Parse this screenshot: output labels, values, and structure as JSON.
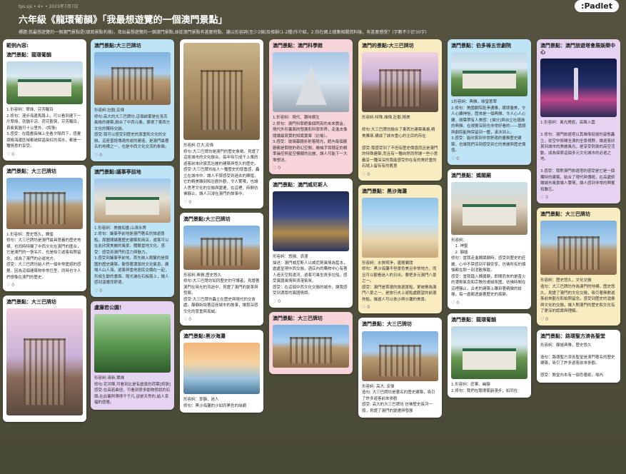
{
  "header": {
    "meta": "tps.sjs • 4+ • 2025年7月7日",
    "title": "六年級《龍環葡韻》「我最想遊覽的一個澳門景點」",
    "subtitle": "標題:我最想遊覽的一個澳門景點是(填寫景點名稱)，寫出最想遊覽的一個澳門景點,並從澳門景點有甚麼特點、讓以形容詞(至少2個)及修辭(1-2種)作介紹，2.你在網上搜集相關資料後，有甚麼感受？(字數不少於30字)",
    "logo": ":Padlet"
  },
  "columns": [
    {
      "cards": [
        {
          "color": "white",
          "title": "範例內容:",
          "subtitle": "澳門景點：龍環葡韻",
          "img": "img-green",
          "imgh": 60,
          "shape": "building",
          "body": "1.形容詞：翠綠、芬芳醒目\n2.修句：漫步海邊馬路上，可以看到建下一片翠綠，就猶平涼、荷花觀賞，芬芳醒目，真氣氣猶可十公里外。(誇張)\n3.感受：在踏盡長梯上坐看夕陽西下，感覺領略海邊區域都被餘昌染紅的海水，都是一種情意的享受。",
          "reacts": "0"
        },
        {
          "color": "white",
          "title": "澳門景點：大三巴牌坊",
          "subtitle": "",
          "img": "img-ruins",
          "imgh": 72,
          "shape": "facade",
          "body": "1.形容詞：歷史悠久，輝煌\n修句：大三巴牌坊是澳門最具意義的歷史地標，也同時特顯了中西文化在澳門的匯合，它是澳門的一張名片，也是吸引遊客拍照留念，成為了澳門的必遊地方。\n感受：大三巴牌坊給人們一個非常震撼的感覺，因為這個建築物非常巨型，同時也令人們想像在澳門的歷史。",
          "reacts": "0"
        },
        {
          "color": "white",
          "title": "澳門景點：大三巴牌坊",
          "subtitle": "",
          "img": "img-ruinsdusk",
          "imgh": 150,
          "shape": "facade",
          "body": "",
          "reacts": ""
        }
      ]
    },
    {
      "cards": [
        {
          "color": "blue",
          "title": "澳門景點:大三巴牌坊",
          "subtitle": "",
          "img": "img-ruins",
          "imgh": 74,
          "shape": "facade",
          "body": "形容詞:壯觀,宏偉\n修句:高大的大三巴牌坊,這個啟蒙是在洛克風格的建築,融合了中西元素，展現了東西方文化的獨特交融。\n感受:我可以感受到歷史的厚重和文化的交融，這座曾經傳達的遊的建造，是澳門最著名的地標之一，也是中西文化交流的象徵。",
          "reacts": "0"
        },
        {
          "color": "blue",
          "title": "澳門景點:議事亭前地",
          "subtitle": "",
          "img": "img-street",
          "imgh": 62,
          "shape": "building",
          "body": "1.形容詞：美麗如畫,山清水秀\n2.修句：議事亭前地是澳門著名的旅遊景點，周圍環繞著歷史建築和商店，遊客可以在此欣賞美麗的風景，體驗當地文化。感受：感受到澳門的活力與魅力。\n3.感受到議事亭前地，首先映入眼簾的是周圍的歷史建築，散發著濃厚的文化氣息，廣場人山人海，遊客與當地居民交織在一起，形成生動的畫面。陽光灑在石板路上，讓人感到溫暖而舒適。",
          "reacts": "0"
        },
        {
          "color": "purple",
          "title": "盧廉若公園！",
          "subtitle": "",
          "img": "img-garden",
          "imgh": 82,
          "shape": "",
          "body": "形容詞:清新,翠綠\n修句:花河陣,可看到比是有處景的荷葉[誇張]　　感受:在高若曲徑，可看到很多動物很狀的石頭,在此裏則博得千千凡,卻是天然的,給人幸福的感覺。",
          "reacts": ""
        }
      ]
    },
    {
      "cards": [
        {
          "color": "white",
          "title": "",
          "subtitle": "",
          "img": "img-stone",
          "imgh": 136,
          "shape": "facade",
          "body": "形容詞:巨大,宏偉\n修句:大三巴牌坊是澳門的歷史象徵，見證了這座城市的文化融合，每年吸引成千上萬的遊客前來欣賞其壯麗的建築與悠久的歷史。\n感受:大三巴牌坊給人一種歷史的厚重感，矗立在城市中，讓人不禁感受到過去的輝煌，它的精美雕刻和壯觀外觀，令人驚嘆，也讓人思考文化的交融與變遷，在這裡，時間彷彿靜止，讓人沉浸在澳門的故事中。",
          "reacts": "0"
        },
        {
          "color": "white",
          "title": "澳門景點:大三巴牌坊",
          "subtitle": "",
          "img": "img-ruins",
          "imgh": 62,
          "shape": "facade",
          "body": "形容詞:典雅,歷史悠久\n修句:大三巴牌坊如同歷史的守護者，見證著澳門在時光的流逝中，見證了澳門的變革與發展。\n感受:大三巴牌坊矗立在歷史與現代的交會處，靜靜訴說著這座城市的故事，讓我深感文化的厚重與真誠。",
          "reacts": "0"
        },
        {
          "color": "white",
          "title": "澳門景點:黑沙海灘",
          "subtitle": "",
          "img": "img-sunset",
          "imgh": 72,
          "shape": "",
          "body": "形容詞：寧靜，迷人\n修句：黑沙海灘的沙如同黑色的絲綢",
          "reacts": ""
        }
      ]
    },
    {
      "cards": [
        {
          "color": "pink",
          "title": "澳門景點：澳門科學館",
          "subtitle": "",
          "img": "img-science",
          "imgh": 84,
          "shape": "cone",
          "body": "1.形容詞：現代、趣味横生\n2.修句：澳門科學館像個閃亮的未來寶盒，現代外形裏面的發展和科學世界，走進去像閱讀最寫實的知識寶庫（比喻）。\n3.感受：玻璃幕牆折射着陽光，館內每個展廳都是問號的奇幻空間，機械手臂穩定的精準操控與星空模擬的壯麗，讓人可能下一大堆想法。",
          "reacts": "0"
        },
        {
          "color": "white",
          "title": "澳門景點：澳門威尼斯人",
          "subtitle": "",
          "img": "img-venice",
          "imgh": 84,
          "shape": "",
          "body": "形容詞：悠揚、浪漫\n描述：澳門威尼斯人以威尼斯風情為藍本，處處呈現中西交融，酒店內的購物中心有著人造天空和運河，遊客可乘坐貢多拉船，感受異國風情與浪漫氣氛。\n感受：在這個中西文化交融的城市，讓我感受到濃厚的異國情調。",
          "reacts": "0"
        },
        {
          "color": "pink",
          "title": "澳門景點：大三巴牌坊",
          "subtitle": "",
          "img": "img-ruins",
          "imgh": 60,
          "shape": "facade",
          "body": "",
          "reacts": ""
        }
      ]
    },
    {
      "cards": [
        {
          "color": "yellow",
          "title": "澳門的景點:大三巴牌坊",
          "subtitle": "",
          "img": "img-ruinsdusk",
          "imgh": 84,
          "shape": "facade",
          "body": "形容詞:特殊,雄偉,壯觀,精美\n\n修句:大三巴牌坊融合了東西方建築風格,精美雕琢,構成了城市重心的注目的存在\n\n感受:我感受到了不但有歷史價值而且是澳門的特殊建築,而且有一種自然而然讓一些小意義享一種深深的我能感受你在有的美好重的石縫上留有有的舊意",
          "reacts": "0"
        },
        {
          "color": "yellow",
          "title": "澳門景點：黑沙海灘",
          "subtitle": "",
          "img": "img-sea",
          "imgh": 84,
          "shape": "",
          "body": "形容詞：水質明淨，邊層廣闊\n修句：黑沙海灘不但景色美且非常地方，而且可以觀看迷人的日出，要把多元澳門八景之一。\n感受：澳門是首選的旅遊景點，更被譽為澳門八景之一，是旅行夫上遊點處觀望的前選熱點，讓遊人可以依沙與沙灘的美景。",
          "reacts": "0"
        },
        {
          "color": "white",
          "title": "澳門景點：大三巴牌坊",
          "subtitle": "",
          "img": "img-ruins",
          "imgh": 70,
          "shape": "facade",
          "body": "形容詞: 高大, 宏偉\n造句: 大三巴牌坊是著名的歷史建築，吸引了許多遊客前來參觀\n感受: 高大的大三巴牌坊 彷彿歷史長河一般，見證了澳門的變遷與發展",
          "reacts": ""
        }
      ]
    },
    {
      "cards": [
        {
          "color": "blue",
          "title": "澳門景點：伯多祿五世劇院",
          "subtitle": "",
          "img": "img-green",
          "imgh": 62,
          "shape": "building",
          "body": "1形容詞：典雅，綠瑩蔥翠\n2.修句：美國劇院乾淨通雅，環境優美，令人心曠神怡，歷來是一個典雅、令人心人心曠、綠葉帶有人美感：[描分]與自立社蘊綠的典雅、在視覺深刻也非常好看的——震撼與劇院能夠保留到一體，漾沐到上。\n3.感受：能欣賞到非常舒適的優雅歷史建築，也讓我們深刻感受到它的美麗與歷史價值。",
          "reacts": "0"
        },
        {
          "color": "white",
          "title": "澳門景點：媽閣廟",
          "subtitle": "",
          "img": "img-temple",
          "imgh": 74,
          "shape": "building",
          "body": "形容詞：\n　1. 神聖\n　2. 靜謐\n修句：當我走進媽閣廟時，感受到歷史的莊嚴，心中不禁感到平靜安寧，彷彿所有的煩惱都在那一刻消散無蹤。\n感受：當我踏入媽閣廟，即聞而來的是香火的濃郁氣息和宗教的虔誠氛圍，彷彿時間在這裡靜止，古老的建築上雕刻著精緻的紋樣，每一處都透露著歷史的痕跡。",
          "reacts": "0"
        },
        {
          "color": "white",
          "title": "澳門景點：龍環葡韻",
          "subtitle": "",
          "img": "img-green",
          "imgh": 74,
          "shape": "building",
          "body": "1.形容詞：莊華、幽靜\n2.修句：我們在龍環葡韻漫步，如同在",
          "reacts": ""
        }
      ]
    },
    {
      "cards": [
        {
          "color": "purple",
          "title": "澳門景點：澳門旅遊塔會展娛樂中心",
          "subtitle": "",
          "img": "img-night",
          "imgh": 82,
          "shape": "tower",
          "body": "1.形容詞：風光旖旎，高聳入雲\n\n2.修句：澳門旅遊塔以其雄偉挺拔的姿態矗立，從空中俯瞰全澳的全景視野，讓遊客欣賞到城市的美麗風光，是享受刺激的高空活動，成為探索這個多元文化城市的必遊之地。\n\n3.感受：我對澳門旅遊塔的感受是它是一個獨特的建築，結合了現代與傳統，在高處俯瞰城市風景讓人驚嘆，讓人感到非常的興奮和難忘。",
          "reacts": "0"
        },
        {
          "color": "yellow",
          "title": "澳門景點：大三巴牌坊",
          "subtitle": "",
          "img": "img-ruins",
          "imgh": 76,
          "shape": "facade",
          "body": "形容詞：歷史悠久，文化交融\n造句：大三巴牌坊作為澳門的地標，歷史悠久，見證了澳門的文化交融，吸引著無數遊客前來觀光和拍照留念。感受到歷史的滄桑與文化的交融，讓人對澳門的歷史和文化有了更深的認識與理解。",
          "reacts": "0"
        },
        {
          "color": "white",
          "title": "澳門景點：路環聖方濟各聖堂",
          "subtitle": "",
          "img": "",
          "imgh": 0,
          "shape": "",
          "body": "形容詞：靜謐典雅，歷史悠久\n\n造句：路環聖方濟各聖堂是澳門著名的歷史建築，吸引了許多遊客前來參觀。\n\n感受：教堂內本有一個色著紙，場內",
          "reacts": ""
        }
      ]
    }
  ]
}
